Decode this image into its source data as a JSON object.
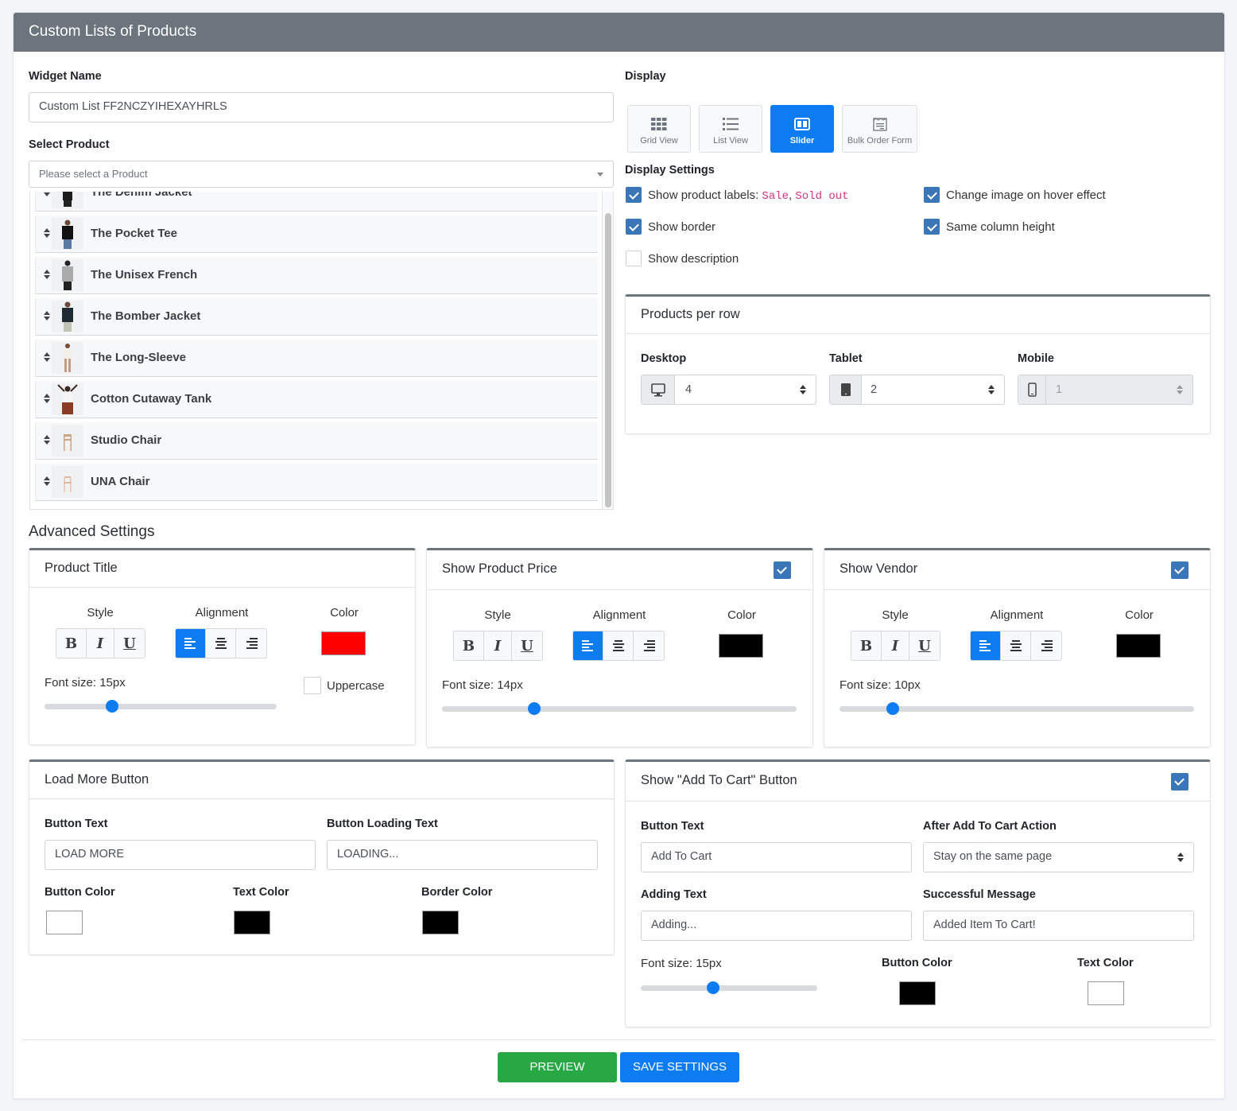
{
  "header": {
    "title": "Custom Lists of Products"
  },
  "widget_name": {
    "label": "Widget Name",
    "value": "Custom List FF2NCZYIHEXAYHRLS"
  },
  "select_product": {
    "label": "Select Product",
    "placeholder": "Please select a Product",
    "items": [
      {
        "name": "The Denim Jacket"
      },
      {
        "name": "The Pocket Tee"
      },
      {
        "name": "The Unisex French"
      },
      {
        "name": "The Bomber Jacket"
      },
      {
        "name": "The Long-Sleeve"
      },
      {
        "name": "Cotton Cutaway Tank"
      },
      {
        "name": "Studio Chair"
      },
      {
        "name": "UNA Chair"
      }
    ]
  },
  "display": {
    "label": "Display",
    "options": [
      {
        "label": "Grid View",
        "icon": "grid-icon",
        "active": false
      },
      {
        "label": "List View",
        "icon": "list-icon",
        "active": false
      },
      {
        "label": "Slider",
        "icon": "slider-icon",
        "active": true
      },
      {
        "label": "Bulk Order Form",
        "icon": "form-icon",
        "active": false
      }
    ]
  },
  "display_settings": {
    "label": "Display Settings",
    "show_labels": {
      "text": "Show product labels: ",
      "tag1": "Sale",
      "sep": ", ",
      "tag2": "Sold out",
      "checked": true
    },
    "show_border": {
      "text": "Show border",
      "checked": true
    },
    "show_description": {
      "text": "Show description",
      "checked": false
    },
    "change_image_hover": {
      "text": "Change image on hover effect",
      "checked": true
    },
    "same_column_height": {
      "text": "Same column height",
      "checked": true
    }
  },
  "products_per_row": {
    "title": "Products per row",
    "desktop": {
      "label": "Desktop",
      "value": "4"
    },
    "tablet": {
      "label": "Tablet",
      "value": "2"
    },
    "mobile": {
      "label": "Mobile",
      "value": "1"
    }
  },
  "advanced": {
    "title": "Advanced Settings",
    "common": {
      "style": "Style",
      "alignment": "Alignment",
      "color": "Color",
      "bold": "B",
      "italic": "I",
      "underline": "U"
    },
    "product_title": {
      "title": "Product Title",
      "font_size": "Font size: 15px",
      "font_size_value": 15,
      "slider_fraction": 0.29,
      "color": "#ff0000",
      "uppercase_label": "Uppercase",
      "uppercase": false
    },
    "product_price": {
      "title": "Show Product Price",
      "checked": true,
      "font_size": "Font size: 14px",
      "font_size_value": 14,
      "slider_fraction": 0.26,
      "color": "#000000"
    },
    "vendor": {
      "title": "Show Vendor",
      "checked": true,
      "font_size": "Font size: 10px",
      "font_size_value": 10,
      "slider_fraction": 0.15,
      "color": "#000000"
    }
  },
  "load_more": {
    "title": "Load More Button",
    "button_text_label": "Button Text",
    "button_text": "LOAD MORE",
    "loading_text_label": "Button Loading Text",
    "loading_text": "LOADING...",
    "button_color_label": "Button Color",
    "button_color": "#ffffff",
    "text_color_label": "Text Color",
    "text_color": "#000000",
    "border_color_label": "Border Color",
    "border_color": "#000000"
  },
  "add_to_cart": {
    "title": "Show \"Add To Cart\" Button",
    "checked": true,
    "button_text_label": "Button Text",
    "button_text": "Add To Cart",
    "after_action_label": "After Add To Cart Action",
    "after_action": "Stay on the same page",
    "adding_text_label": "Adding Text",
    "adding_text": "Adding...",
    "success_label": "Successful Message",
    "success_text": "Added Item To Cart!",
    "font_size": "Font size: 15px",
    "font_size_value": 15,
    "slider_fraction": 0.41,
    "button_color_label": "Button Color",
    "button_color": "#000000",
    "text_color_label": "Text Color",
    "text_color": "#ffffff"
  },
  "footer": {
    "preview": "PREVIEW",
    "save": "SAVE SETTINGS",
    "preview_color": "#28a745",
    "save_color": "#0d7bf2"
  }
}
